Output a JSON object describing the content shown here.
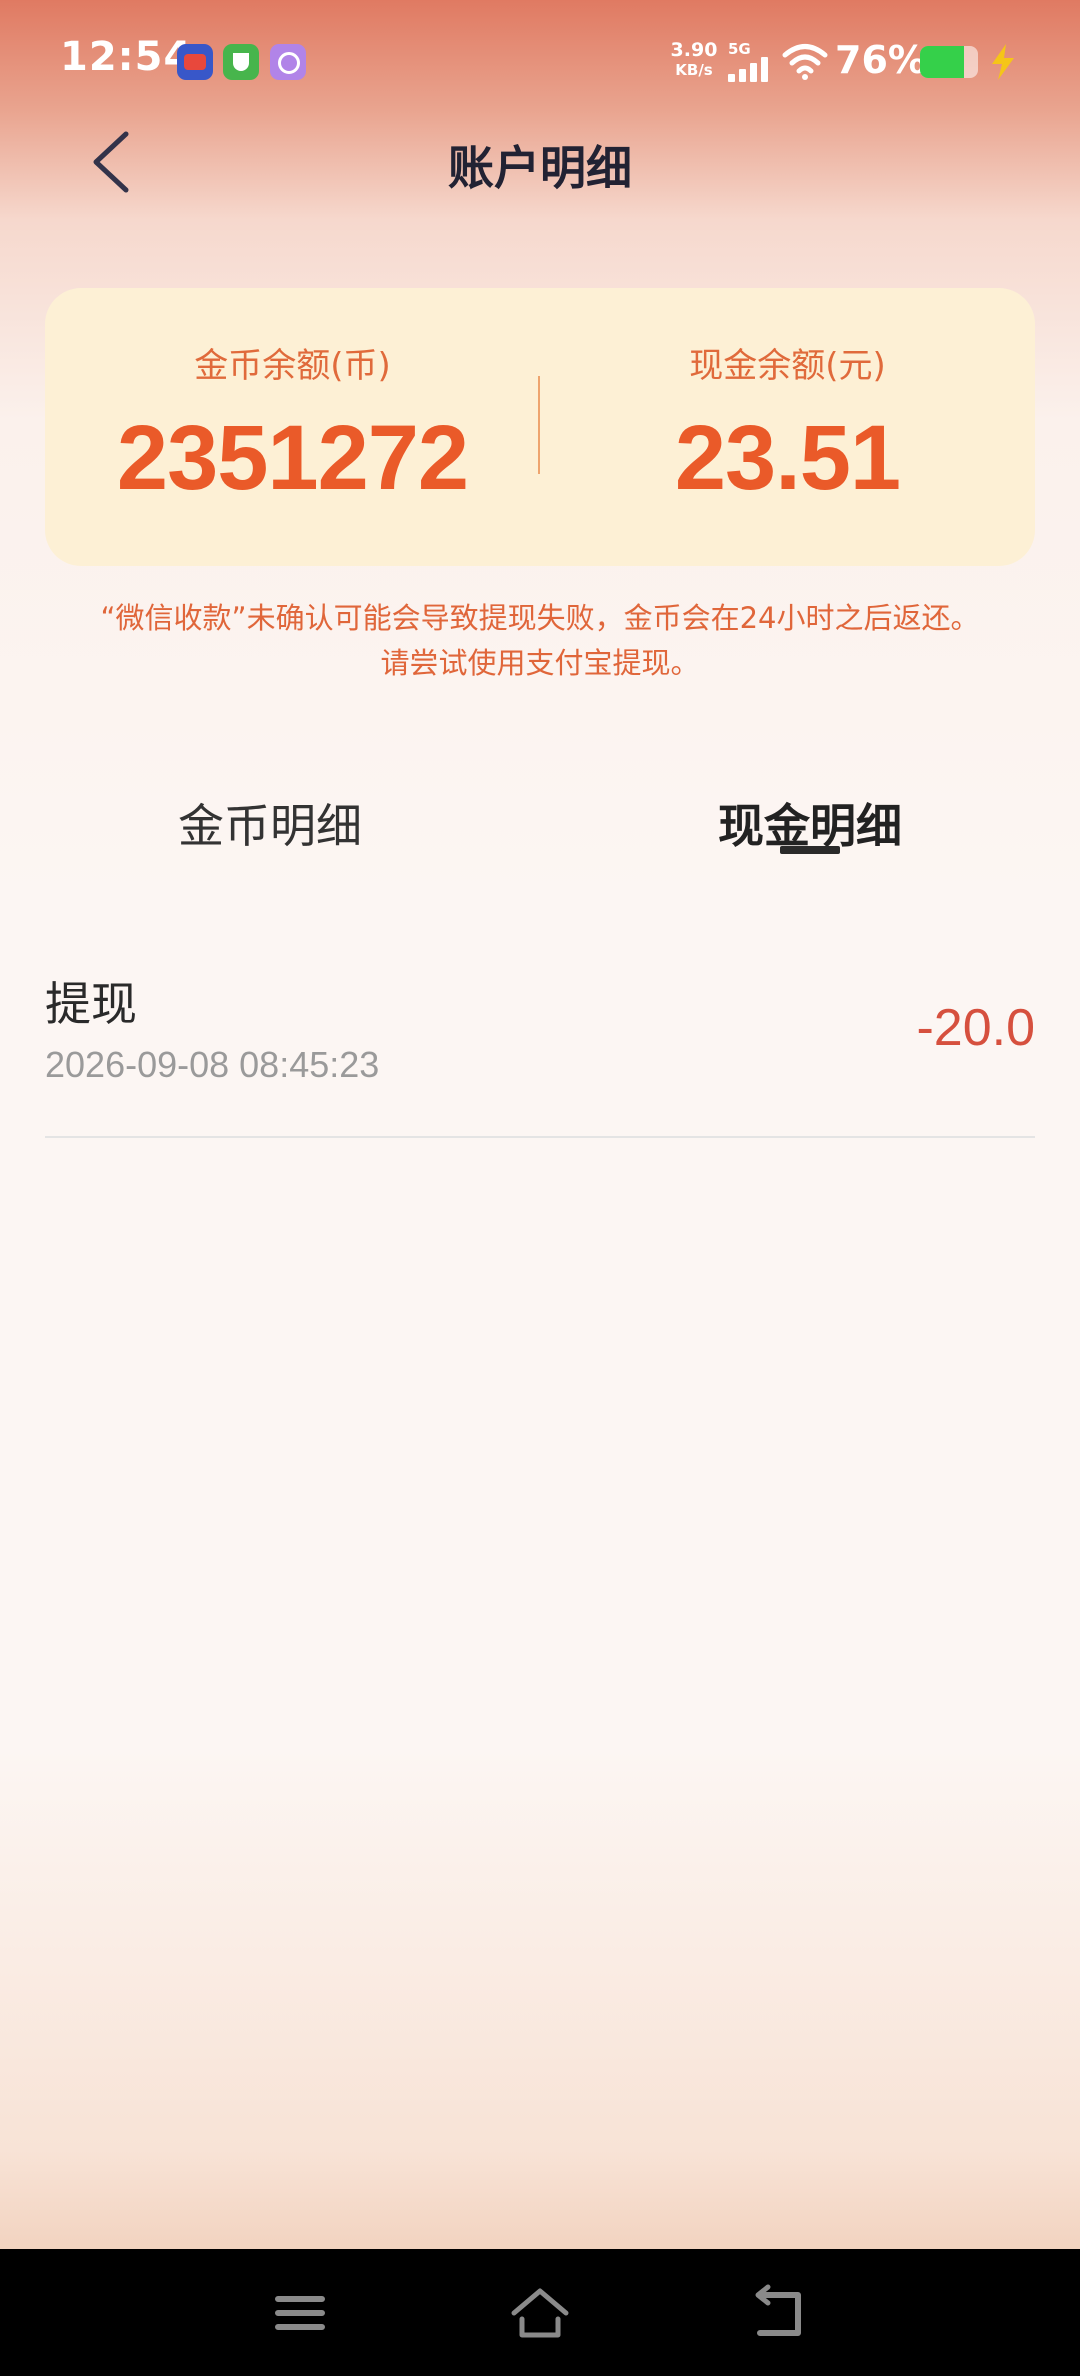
{
  "status_bar": {
    "time": "12:54",
    "net_speed_value": "3.90",
    "net_speed_unit": "KB/s",
    "network_type": "5G",
    "battery_percent": "76%",
    "battery_level": 0.76,
    "app_icons": [
      "short-drama-app-icon",
      "security-app-icon",
      "purple-app-icon"
    ]
  },
  "header": {
    "title": "账户明细",
    "back_icon": "chevron-left-icon"
  },
  "balance": {
    "coin": {
      "label": "金币余额(币)",
      "value": "2351272"
    },
    "cash": {
      "label": "现金余额(元)",
      "value": "23.51"
    }
  },
  "notice": {
    "line1": "“微信收款”未确认可能会导致提现失败，金币会在24小时之后返还。",
    "line2": "请尝试使用支付宝提现。"
  },
  "tabs": [
    {
      "label": "金币明细",
      "active": false
    },
    {
      "label": "现金明细",
      "active": true
    }
  ],
  "records": [
    {
      "title": "提现",
      "time": "2026-09-08 08:45:23",
      "amount": "-20.0"
    }
  ],
  "nav": {
    "menu_icon": "menu-icon",
    "home_icon": "home-icon",
    "back_icon": "back-icon"
  },
  "colors": {
    "accent": "#ea5a29",
    "card_bg": "#fdf0d5",
    "amount_negative": "#d6503e"
  }
}
